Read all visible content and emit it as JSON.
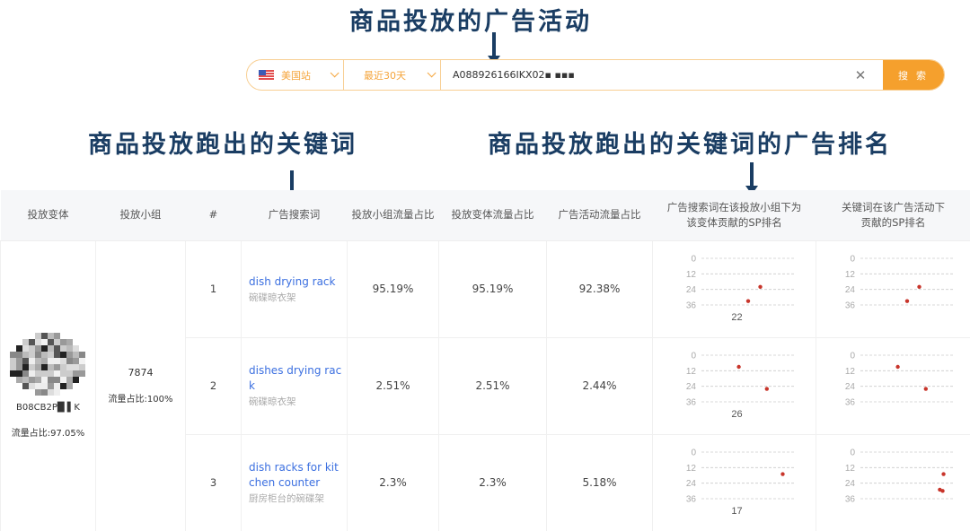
{
  "annotations": {
    "campaign": "商品投放的广告活动",
    "keywords": "商品投放跑出的关键词",
    "ranking": "商品投放跑出的关键词的广告排名"
  },
  "search": {
    "site": "美国站",
    "site_icon": "us-flag-icon",
    "range": "最近30天",
    "query": "A088926166IKX02▪ ▪▪▪",
    "clear_icon": "close-icon",
    "button": "搜 索"
  },
  "colors": {
    "accent": "#f5a02d",
    "border": "#f8cf93",
    "link": "#3b6fe0",
    "annotation": "#1a3d63",
    "dot": "#c8352b"
  },
  "table": {
    "headers": [
      "投放变体",
      "投放小组",
      "#",
      "广告搜索词",
      "投放小组流量占比",
      "投放变体流量占比",
      "广告活动流量占比",
      "广告搜索词在该投放小组下为该变体贡献的SP排名",
      "关键词在该广告活动下贡献的SP排名"
    ],
    "header_lines": {
      "h7a": "广告搜索词在该投放小组下为",
      "h7b": "该变体贡献的SP排名",
      "h8a": "关键词在该广告活动下",
      "h8b": "贡献的SP排名"
    },
    "variant": {
      "asin": "B08CB2P█ ▌K",
      "share": "流量占比:97.05%"
    },
    "group": {
      "id": "7874",
      "share": "流量占比:100%"
    },
    "rows": [
      {
        "index": "1",
        "keyword": "dish drying rack",
        "keyword_cn": "碗碟晾衣架",
        "group_pct": "95.19%",
        "variant_pct": "95.19%",
        "campaign_pct": "92.38%",
        "rank_label": "22"
      },
      {
        "index": "2",
        "keyword": "dishes drying rack",
        "keyword_cn": "碗碟晾衣架",
        "group_pct": "2.51%",
        "variant_pct": "2.51%",
        "campaign_pct": "2.44%",
        "rank_label": "26"
      },
      {
        "index": "3",
        "keyword": "dish racks for kitchen counter",
        "keyword_cn": "厨房柜台的碗碟架",
        "group_pct": "2.3%",
        "variant_pct": "2.3%",
        "campaign_pct": "5.18%",
        "rank_label": "17"
      }
    ]
  },
  "chart_data": [
    {
      "type": "scatter",
      "title": "row1-variant-rank",
      "y_ticks": [
        0,
        12,
        24,
        36
      ],
      "ylim": [
        0,
        36
      ],
      "inverted_y": true,
      "points": [
        {
          "x": 0.5,
          "y": 33
        },
        {
          "x": 0.63,
          "y": 22
        }
      ],
      "label": "22"
    },
    {
      "type": "scatter",
      "title": "row1-campaign-rank",
      "y_ticks": [
        0,
        12,
        24,
        36
      ],
      "ylim": [
        0,
        36
      ],
      "inverted_y": true,
      "points": [
        {
          "x": 0.5,
          "y": 33
        },
        {
          "x": 0.63,
          "y": 22
        }
      ],
      "label": ""
    },
    {
      "type": "scatter",
      "title": "row2-variant-rank",
      "y_ticks": [
        0,
        12,
        24,
        36
      ],
      "ylim": [
        0,
        36
      ],
      "inverted_y": true,
      "points": [
        {
          "x": 0.4,
          "y": 9
        },
        {
          "x": 0.7,
          "y": 26
        }
      ],
      "label": "26"
    },
    {
      "type": "scatter",
      "title": "row2-campaign-rank",
      "y_ticks": [
        0,
        12,
        24,
        36
      ],
      "ylim": [
        0,
        36
      ],
      "inverted_y": true,
      "points": [
        {
          "x": 0.4,
          "y": 9
        },
        {
          "x": 0.7,
          "y": 26
        }
      ],
      "label": ""
    },
    {
      "type": "scatter",
      "title": "row3-variant-rank",
      "y_ticks": [
        0,
        12,
        24,
        36
      ],
      "ylim": [
        0,
        36
      ],
      "inverted_y": true,
      "points": [
        {
          "x": 0.87,
          "y": 17
        }
      ],
      "label": "17"
    },
    {
      "type": "scatter",
      "title": "row3-campaign-rank",
      "y_ticks": [
        0,
        12,
        24,
        36
      ],
      "ylim": [
        0,
        36
      ],
      "inverted_y": true,
      "points": [
        {
          "x": 0.89,
          "y": 17
        },
        {
          "x": 0.85,
          "y": 29
        },
        {
          "x": 0.88,
          "y": 30
        }
      ],
      "label": ""
    }
  ]
}
